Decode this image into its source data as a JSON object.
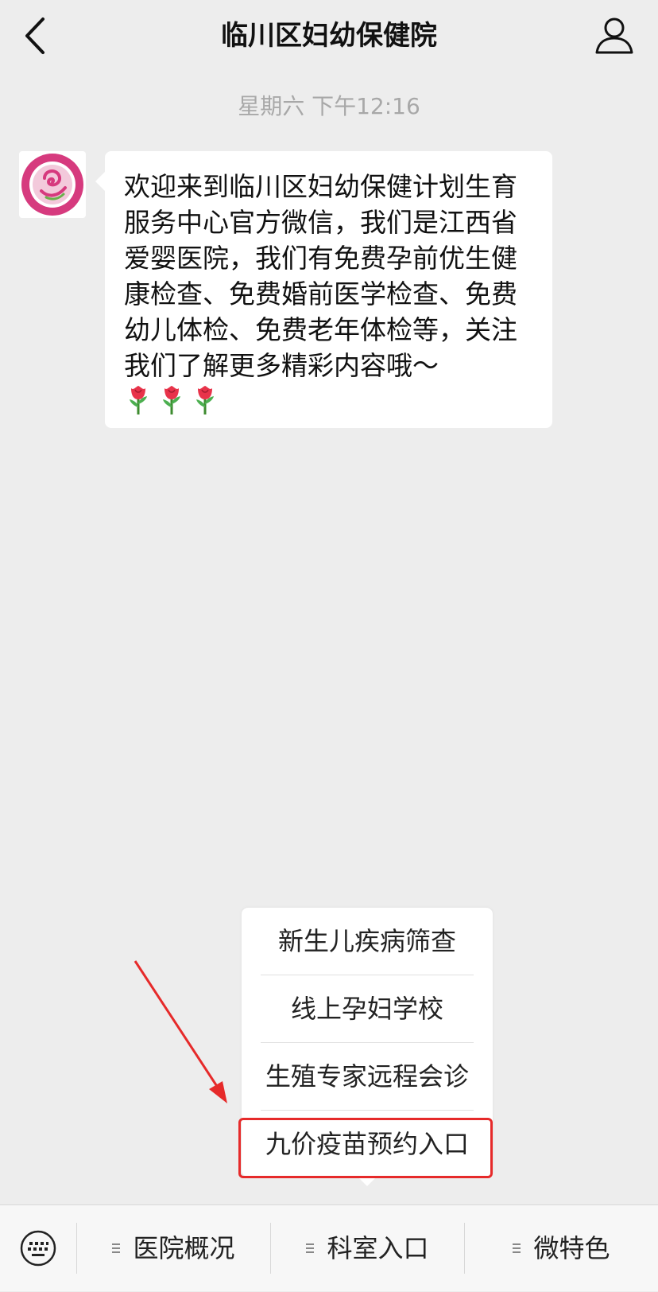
{
  "header": {
    "title": "临川区妇幼保健院",
    "back_icon": "chevron-left-icon",
    "profile_icon": "person-icon"
  },
  "chat": {
    "timestamp": "星期六 下午12:16",
    "message": {
      "avatar": "hospital-logo",
      "text": "欢迎来到临川区妇幼保健计划生育服务中心官方微信，我们是江西省爱婴医院，我们有免费孕前优生健康检查、免费婚前医学检查、免费幼儿体检、免费老年体检等，关注我们了解更多精彩内容哦～",
      "emoji": "rose-icon",
      "emoji_count": 3
    }
  },
  "popup_menu": {
    "items": [
      {
        "label": "新生儿疾病筛查"
      },
      {
        "label": "线上孕妇学校"
      },
      {
        "label": "生殖专家远程会诊"
      },
      {
        "label": "九价疫苗预约入口"
      }
    ],
    "highlighted_index": 3
  },
  "annotation": {
    "color": "#e62a2a"
  },
  "bottom_bar": {
    "keyboard_icon": "keyboard-icon",
    "tabs": [
      {
        "label": "医院概况"
      },
      {
        "label": "科室入口"
      },
      {
        "label": "微特色"
      }
    ]
  },
  "colors": {
    "background": "#ededed",
    "bubble": "#ffffff",
    "timestamp": "#a8a8a8",
    "logo_pink": "#d63a7e"
  }
}
